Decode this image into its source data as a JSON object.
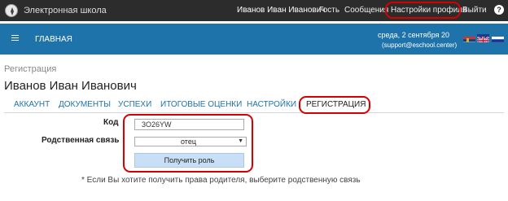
{
  "topbar": {
    "app_title": "Электронная школа",
    "user_name": "Иванов Иван Иванович",
    "guest": "Гость",
    "messages": "Сообщения",
    "profile_settings": "Настройки профиля",
    "logout": "Выйти",
    "help_icon": "?"
  },
  "navbar": {
    "home": "ГЛАВНАЯ",
    "date": "среда, 2 сентября 20",
    "support": "(support@eschool.center)",
    "flags": [
      "flag-rs-icon",
      "flag-uk-icon",
      "flag-ru-icon"
    ]
  },
  "page": {
    "breadcrumb": "Регистрация",
    "user_name": "Иванов Иван Иванович",
    "tabs": [
      {
        "label": "АККАУНТ"
      },
      {
        "label": "ДОКУМЕНТЫ"
      },
      {
        "label": "УСПЕХИ"
      },
      {
        "label": "ИТОГОВЫЕ ОЦЕНКИ"
      },
      {
        "label": "НАСТРОЙКИ"
      },
      {
        "label": "РЕГИСТРАЦИЯ",
        "active": true
      }
    ]
  },
  "form": {
    "code_label": "Код",
    "code_value": "3O26YW",
    "relation_label": "Родственная связь",
    "relation_value": "отец",
    "submit_label": "Получить роль",
    "note": "* Если Вы хотите получить права родителя, выберите родственную связь"
  },
  "colors": {
    "topbar_bg": "#2c2c2c",
    "navbar_bg": "#1e73aa",
    "link": "#1e73aa",
    "highlight": "#d60000",
    "button_bg": "#c9dff5"
  }
}
